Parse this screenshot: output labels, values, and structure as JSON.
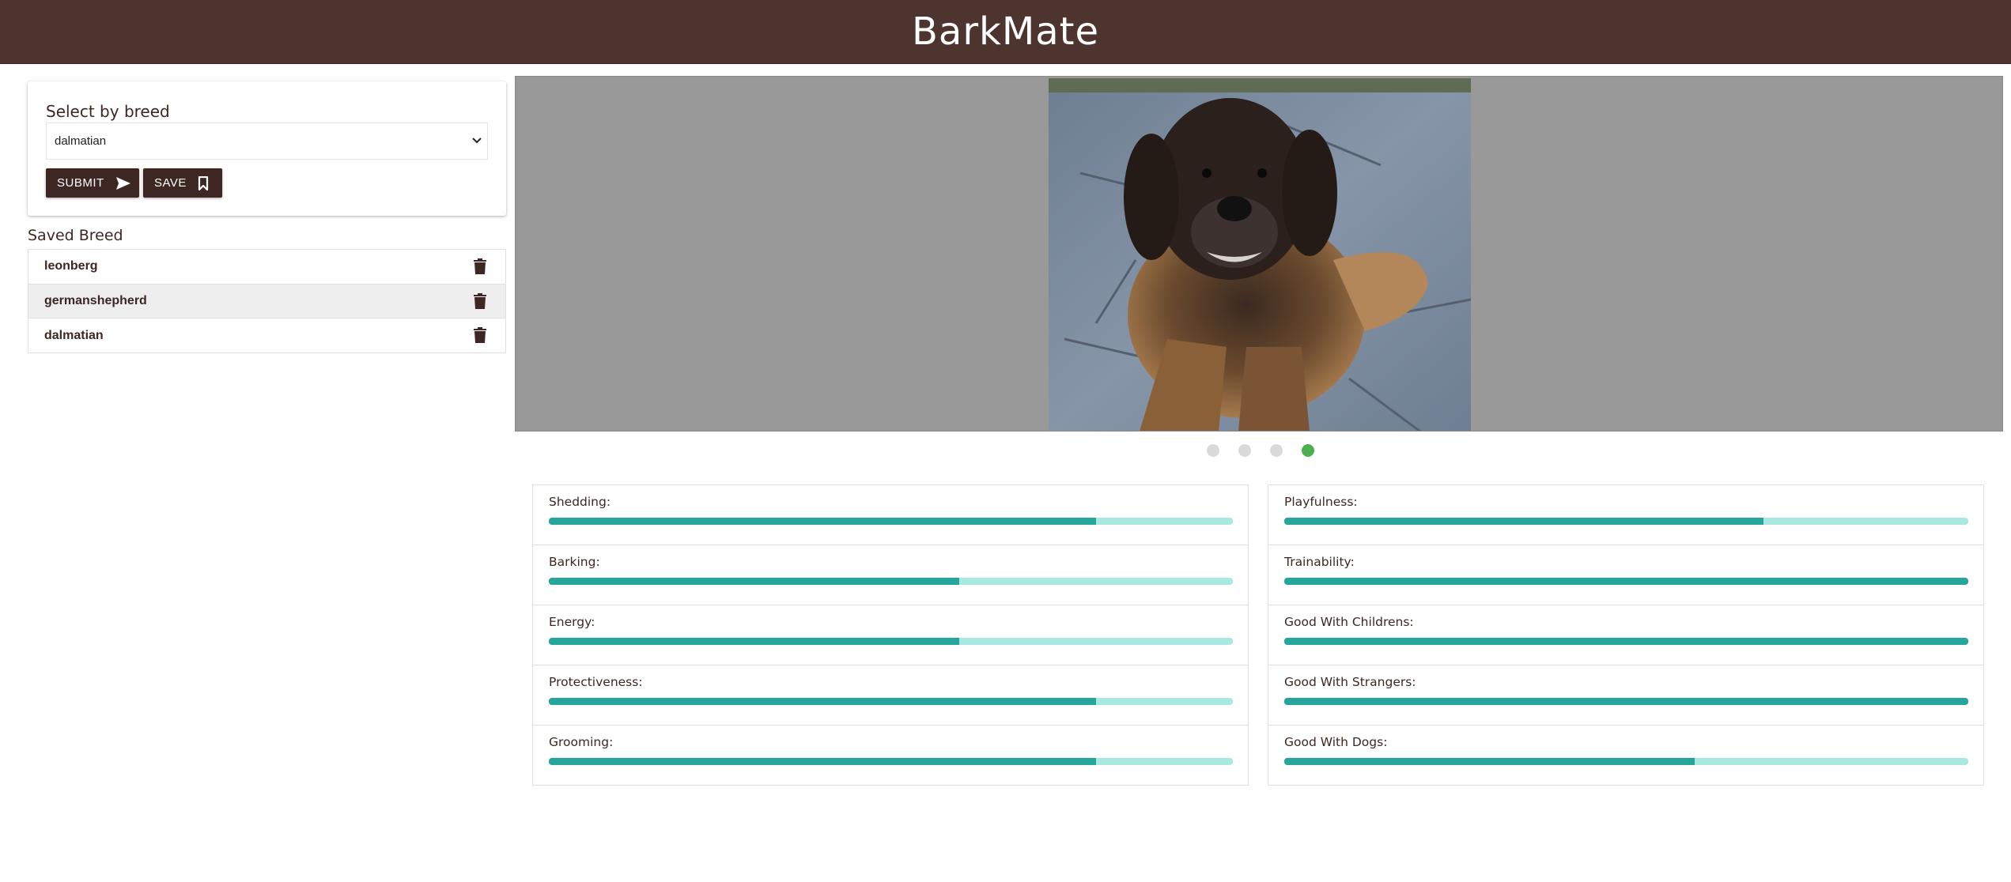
{
  "app": {
    "title": "BarkMate"
  },
  "breed_select": {
    "label": "Select by breed",
    "selected": "dalmatian",
    "submit_label": "SUBMIT",
    "save_label": "SAVE"
  },
  "saved": {
    "title": "Saved Breed",
    "items": [
      {
        "name": "leonberg",
        "active": false
      },
      {
        "name": "germanshepherd",
        "active": true
      },
      {
        "name": "dalmatian",
        "active": false
      }
    ]
  },
  "carousel": {
    "image_icon": "leonberger-dog-photo",
    "slide_count": 4,
    "active_index": 3
  },
  "stats": {
    "left": [
      {
        "label": "Shedding:",
        "value": 0.8
      },
      {
        "label": "Barking:",
        "value": 0.6
      },
      {
        "label": "Energy:",
        "value": 0.6
      },
      {
        "label": "Protectiveness:",
        "value": 0.8
      },
      {
        "label": "Grooming:",
        "value": 0.8
      }
    ],
    "right": [
      {
        "label": "Playfulness:",
        "value": 0.7
      },
      {
        "label": "Trainability:",
        "value": 1.0
      },
      {
        "label": "Good With Childrens:",
        "value": 1.0
      },
      {
        "label": "Good With Strangers:",
        "value": 1.0
      },
      {
        "label": "Good With Dogs:",
        "value": 0.6
      }
    ]
  },
  "colors": {
    "header": "#4e342e",
    "primary_dark": "#3e2723",
    "bar_fill": "#26a69a",
    "bar_track": "#a7e8e1",
    "dot_active": "#4caf50"
  }
}
